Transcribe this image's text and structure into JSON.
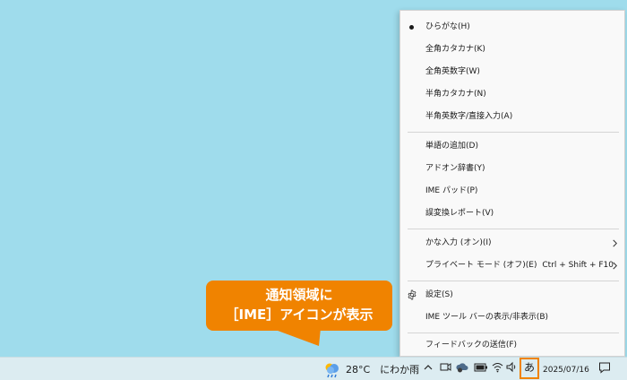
{
  "ime_menu": {
    "items": [
      {
        "label": "ひらがな(H)",
        "selected": true
      },
      {
        "label": "全角カタカナ(K)"
      },
      {
        "label": "全角英数字(W)"
      },
      {
        "label": "半角カタカナ(N)"
      },
      {
        "label": "半角英数字/直接入力(A)"
      },
      {
        "label": "単語の追加(D)"
      },
      {
        "label": "アドオン辞書(Y)"
      },
      {
        "label": "IME パッド(P)"
      },
      {
        "label": "誤変換レポート(V)"
      },
      {
        "label": "かな入力 (オン)(I)",
        "submenu": true
      },
      {
        "label": "プライベート モード (オフ)(E)",
        "shortcut": "Ctrl + Shift + F10",
        "submenu": true
      },
      {
        "label": "設定(S)",
        "icon": "gear-icon"
      },
      {
        "label": "IME ツール バーの表示/非表示(B)"
      },
      {
        "label": "フィードバックの送信(F)"
      }
    ]
  },
  "callout": {
    "line1": "通知領域に",
    "line2": "［IME］アイコンが表示",
    "color": "#f08300"
  },
  "taskbar": {
    "weather": "28°C　にわか雨",
    "ime_indicator": "あ",
    "date": "2025/07/16",
    "tray_icons": [
      "chevron-up-icon",
      "meet-now-icon",
      "cloud-sync-icon",
      "battery-icon",
      "wifi-icon",
      "speaker-icon",
      "notification-icon"
    ]
  }
}
